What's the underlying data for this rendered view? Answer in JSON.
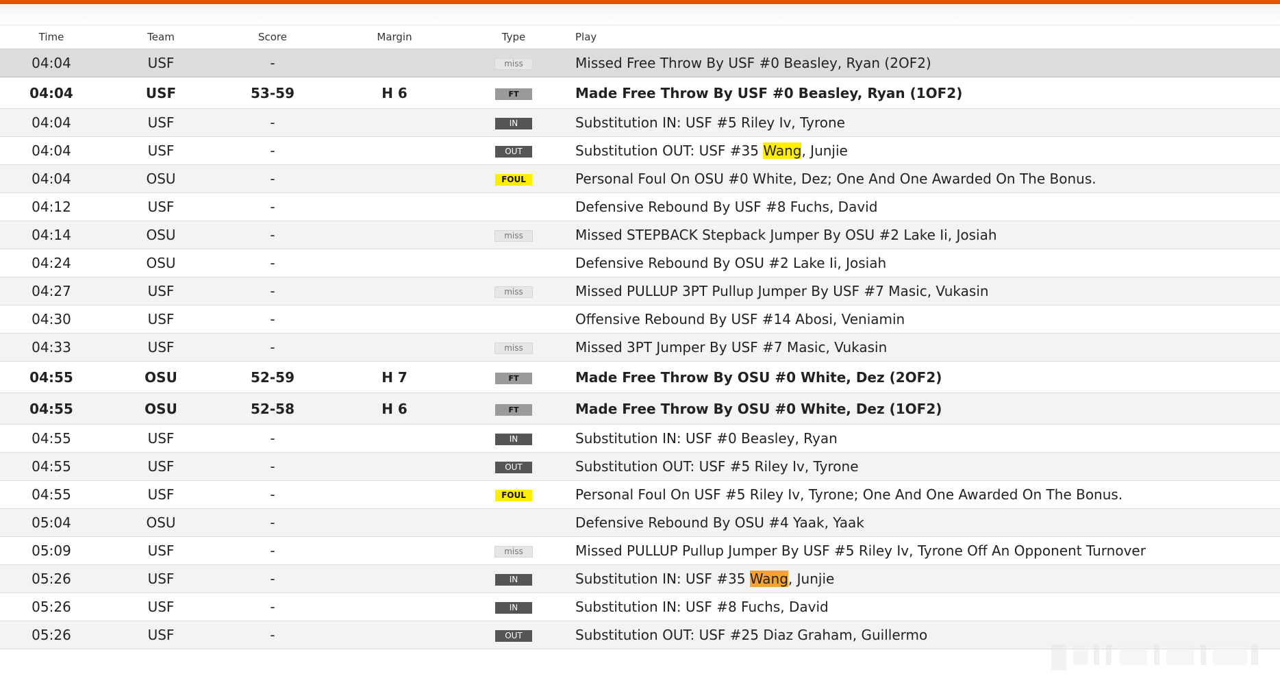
{
  "header": {
    "time": "Time",
    "team": "Team",
    "score": "Score",
    "margin": "Margin",
    "type": "Type",
    "play": "Play"
  },
  "rows": [
    {
      "time": "04:04",
      "team": "USF",
      "score": "-",
      "margin": "",
      "type": "miss",
      "play_pre": "Missed Free Throw By USF #0 Beasley, Ryan (2OF2)",
      "hl": "",
      "play_post": ""
    },
    {
      "time": "04:04",
      "team": "USF",
      "score": "53-59",
      "margin": "H 6",
      "type": "FT",
      "play_pre": "Made Free Throw By USF #0 Beasley, Ryan (1OF2)",
      "hl": "",
      "play_post": ""
    },
    {
      "time": "04:04",
      "team": "USF",
      "score": "-",
      "margin": "",
      "type": "IN",
      "play_pre": "Substitution IN: USF #5 Riley Iv, Tyrone",
      "hl": "",
      "play_post": ""
    },
    {
      "time": "04:04",
      "team": "USF",
      "score": "-",
      "margin": "",
      "type": "OUT",
      "play_pre": "Substitution OUT: USF #35 ",
      "hl": "Wang",
      "play_post": ", Junjie"
    },
    {
      "time": "04:04",
      "team": "OSU",
      "score": "-",
      "margin": "",
      "type": "FOUL",
      "play_pre": "Personal Foul On OSU #0 White, Dez; One And One Awarded On The Bonus.",
      "hl": "",
      "play_post": ""
    },
    {
      "time": "04:12",
      "team": "USF",
      "score": "-",
      "margin": "",
      "type": "",
      "play_pre": "Defensive Rebound By USF #8 Fuchs, David",
      "hl": "",
      "play_post": ""
    },
    {
      "time": "04:14",
      "team": "OSU",
      "score": "-",
      "margin": "",
      "type": "miss",
      "play_pre": "Missed STEPBACK Stepback Jumper By OSU #2 Lake Ii, Josiah",
      "hl": "",
      "play_post": ""
    },
    {
      "time": "04:24",
      "team": "OSU",
      "score": "-",
      "margin": "",
      "type": "",
      "play_pre": "Defensive Rebound By OSU #2 Lake Ii, Josiah",
      "hl": "",
      "play_post": ""
    },
    {
      "time": "04:27",
      "team": "USF",
      "score": "-",
      "margin": "",
      "type": "miss",
      "play_pre": "Missed PULLUP 3PT Pullup Jumper By USF #7 Masic, Vukasin",
      "hl": "",
      "play_post": ""
    },
    {
      "time": "04:30",
      "team": "USF",
      "score": "-",
      "margin": "",
      "type": "",
      "play_pre": "Offensive Rebound By USF #14 Abosi, Veniamin",
      "hl": "",
      "play_post": ""
    },
    {
      "time": "04:33",
      "team": "USF",
      "score": "-",
      "margin": "",
      "type": "miss",
      "play_pre": "Missed 3PT Jumper By USF #7 Masic, Vukasin",
      "hl": "",
      "play_post": ""
    },
    {
      "time": "04:55",
      "team": "OSU",
      "score": "52-59",
      "margin": "H 7",
      "type": "FT",
      "play_pre": "Made Free Throw By OSU #0 White, Dez (2OF2)",
      "hl": "",
      "play_post": ""
    },
    {
      "time": "04:55",
      "team": "OSU",
      "score": "52-58",
      "margin": "H 6",
      "type": "FT",
      "play_pre": "Made Free Throw By OSU #0 White, Dez (1OF2)",
      "hl": "",
      "play_post": ""
    },
    {
      "time": "04:55",
      "team": "USF",
      "score": "-",
      "margin": "",
      "type": "IN",
      "play_pre": "Substitution IN: USF #0 Beasley, Ryan",
      "hl": "",
      "play_post": ""
    },
    {
      "time": "04:55",
      "team": "USF",
      "score": "-",
      "margin": "",
      "type": "OUT",
      "play_pre": "Substitution OUT: USF #5 Riley Iv, Tyrone",
      "hl": "",
      "play_post": ""
    },
    {
      "time": "04:55",
      "team": "USF",
      "score": "-",
      "margin": "",
      "type": "FOUL",
      "play_pre": "Personal Foul On USF #5 Riley Iv, Tyrone; One And One Awarded On The Bonus.",
      "hl": "",
      "play_post": ""
    },
    {
      "time": "05:04",
      "team": "OSU",
      "score": "-",
      "margin": "",
      "type": "",
      "play_pre": "Defensive Rebound By OSU #4 Yaak, Yaak",
      "hl": "",
      "play_post": ""
    },
    {
      "time": "05:09",
      "team": "USF",
      "score": "-",
      "margin": "",
      "type": "miss",
      "play_pre": "Missed PULLUP Pullup Jumper By USF #5 Riley Iv, Tyrone Off An Opponent Turnover",
      "hl": "",
      "play_post": ""
    },
    {
      "time": "05:26",
      "team": "USF",
      "score": "-",
      "margin": "",
      "type": "IN",
      "play_pre": "Substitution IN: USF #35 ",
      "hl": "Wang",
      "play_post": ", Junjie"
    },
    {
      "time": "05:26",
      "team": "USF",
      "score": "-",
      "margin": "",
      "type": "IN",
      "play_pre": "Substitution IN: USF #8 Fuchs, David",
      "hl": "",
      "play_post": ""
    },
    {
      "time": "05:26",
      "team": "USF",
      "score": "-",
      "margin": "",
      "type": "OUT",
      "play_pre": "Substitution OUT: USF #25 Diaz Graham, Guillermo",
      "hl": "",
      "play_post": ""
    }
  ],
  "colors": {
    "accent": "#e35205",
    "highlight_yellow": "#ffee00",
    "highlight_orange": "#f7a233",
    "hover_row": "#dcdcdc",
    "alt_row": "#f3f3f3"
  }
}
